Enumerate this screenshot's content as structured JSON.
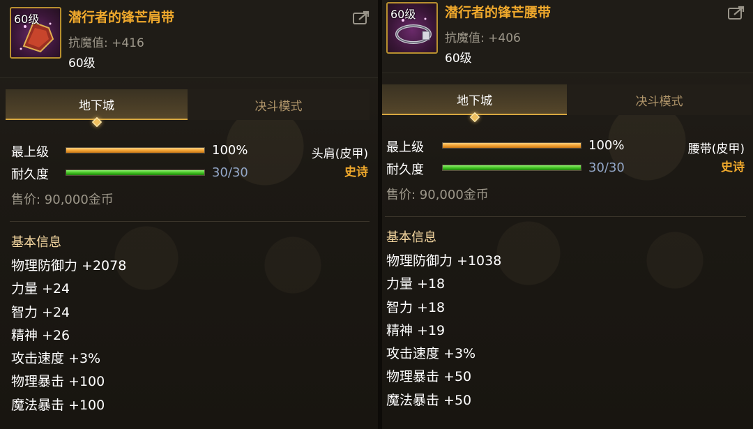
{
  "items": [
    {
      "icon_level": "60级",
      "name": "潜行者的锋芒肩带",
      "magic_resist_label": "抗魔值:",
      "magic_resist_value": "+416",
      "level": "60级",
      "tabs": [
        "地下城",
        "决斗模式"
      ],
      "max_level_label": "最上级",
      "max_level_value": "100%",
      "max_level_fraction": 1.0,
      "durability_label": "耐久度",
      "durability_value": "30/30",
      "durability_fraction": 1.0,
      "slot_type": "头肩(皮甲)",
      "rarity": "史诗",
      "price": "售价: 90,000金币",
      "section_title": "基本信息",
      "stats": [
        "物理防御力 +2078",
        "力量 +24",
        "智力 +24",
        "精神 +26",
        "攻击速度 +3%",
        "物理暴击 +100",
        "魔法暴击 +100"
      ]
    },
    {
      "icon_level": "60级",
      "name": "潜行者的锋芒腰带",
      "magic_resist_label": "抗魔值:",
      "magic_resist_value": "+406",
      "level": "60级",
      "tabs": [
        "地下城",
        "决斗模式"
      ],
      "max_level_label": "最上级",
      "max_level_value": "100%",
      "max_level_fraction": 1.0,
      "durability_label": "耐久度",
      "durability_value": "30/30",
      "durability_fraction": 1.0,
      "slot_type": "腰带(皮甲)",
      "rarity": "史诗",
      "price": "售价: 90,000金币",
      "section_title": "基本信息",
      "stats": [
        "物理防御力 +1038",
        "力量 +18",
        "智力 +18",
        "精神 +19",
        "攻击速度 +3%",
        "物理暴击 +50",
        "魔法暴击 +50"
      ]
    }
  ],
  "icons": {
    "share": "share-icon",
    "shoulder": "shoulder-armor-icon",
    "belt": "belt-icon"
  },
  "colors": {
    "name_gold": "#f0a92c",
    "rarity_epic": "#f0a92c",
    "section_title": "#f5d7a0",
    "durability_blue": "#93a7c8"
  }
}
